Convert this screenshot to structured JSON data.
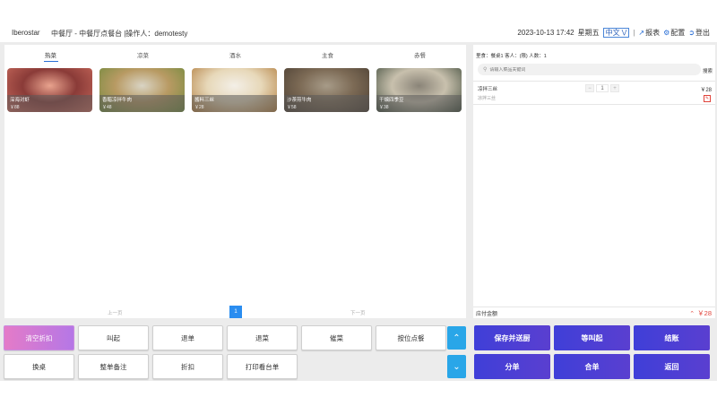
{
  "header": {
    "brand": "Iberostar",
    "location": "中餐厅 - 中餐厅点餐台 |操作人：demotesty",
    "datetime": "2023-10-13 17:42",
    "weekday": "星期五",
    "language": "中文",
    "links": [
      {
        "label": "报表",
        "icon": "chart-icon"
      },
      {
        "label": "配置",
        "icon": "settings-icon"
      },
      {
        "label": "登出",
        "icon": "logout-icon"
      }
    ]
  },
  "categories": [
    "热菜",
    "凉菜",
    "酒水",
    "主食",
    "赤餐"
  ],
  "active_category": 0,
  "dishes": [
    {
      "name": "深海对虾",
      "price": "￥88",
      "colors": [
        "#c96a5c",
        "#8a3b38",
        "#e9a38e"
      ]
    },
    {
      "name": "香醋凉拌牛肉",
      "price": "￥48",
      "colors": [
        "#6f8a3c",
        "#b89a63",
        "#d9d4c4"
      ]
    },
    {
      "name": "酱料三丝",
      "price": "￥28",
      "colors": [
        "#b07a3a",
        "#e7d8b9",
        "#f3efe7"
      ]
    },
    {
      "name": "沙茶煎牛肉",
      "price": "￥58",
      "colors": [
        "#4a3e32",
        "#7c6a55",
        "#a79b88"
      ]
    },
    {
      "name": "干煸四季豆",
      "price": "￥38",
      "colors": [
        "#3e4a3a",
        "#c8c0ad",
        "#8a8478"
      ]
    }
  ],
  "pager": {
    "prev": "上一页",
    "page": "1",
    "next": "下一页"
  },
  "buttons_row1": [
    "清空折扣",
    "叫起",
    "退单",
    "退菜",
    "催菜",
    "按位点餐"
  ],
  "buttons_row2": [
    "换桌",
    "整单备注",
    "折扣",
    "打印看台单"
  ],
  "order": {
    "table_info": "里食：餐桌1 客人：(限) 人数：1",
    "search_placeholder": "请输入菜品关键词",
    "search_button": "搜索",
    "items": [
      {
        "name": "凉拌三丝",
        "sub": "凉拌三丝",
        "qty": "1",
        "price": "￥28"
      }
    ],
    "total_label": "应付金额",
    "total_value": "￥28"
  },
  "actions_row1": [
    "保存并送厨",
    "等叫起",
    "结账"
  ],
  "actions_row2": [
    "分单",
    "合单",
    "返回"
  ]
}
